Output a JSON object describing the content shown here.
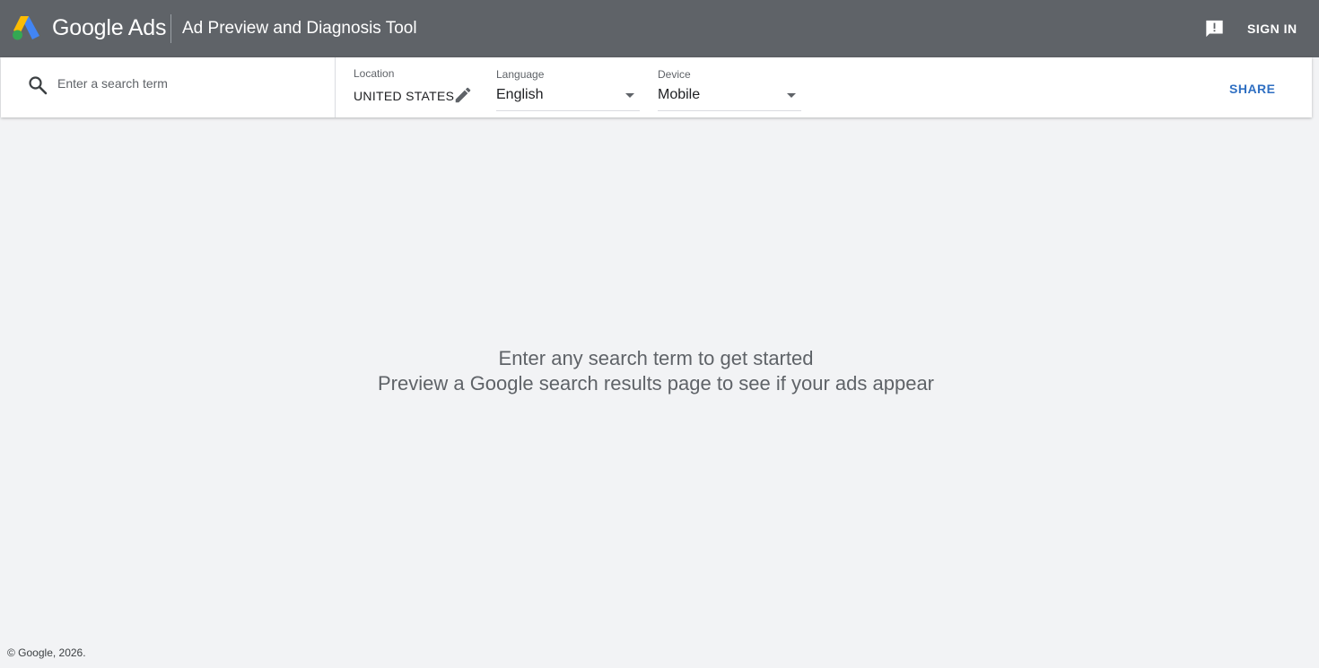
{
  "header": {
    "brand": "Google Ads",
    "tool_title": "Ad Preview and Diagnosis Tool",
    "feedback_icon": "feedback-icon",
    "sign_in_label": "SIGN IN",
    "bg_color": "#5f6368"
  },
  "toolbar": {
    "search": {
      "placeholder": "Enter a search term",
      "value": "",
      "icon": "search-icon"
    },
    "location": {
      "label": "Location",
      "value": "UNITED STATES",
      "edit_icon": "pencil-icon"
    },
    "language": {
      "label": "Language",
      "value": "English"
    },
    "device": {
      "label": "Device",
      "value": "Mobile"
    },
    "share_label": "SHARE",
    "accent_color": "#2f6fc2"
  },
  "empty_state": {
    "line1": "Enter any search term to get started",
    "line2": "Preview a Google search results page to see if your ads appear"
  },
  "footer": {
    "copyright": "© Google, 2026."
  }
}
